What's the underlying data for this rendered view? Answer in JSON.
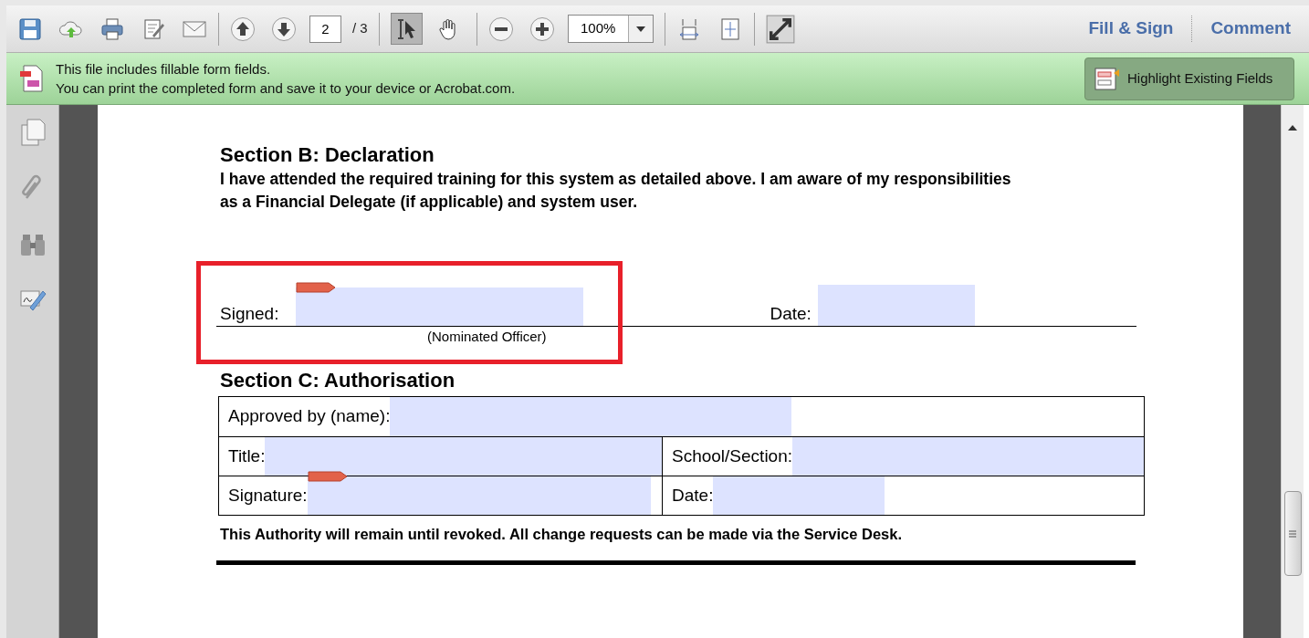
{
  "toolbar": {
    "page_number": "2",
    "page_count": "/ 3",
    "tools": [
      {
        "selected": true
      },
      {
        "selected": false
      }
    ],
    "zoom": "100%",
    "links": [
      "Fill & Sign",
      "Comment"
    ]
  },
  "banner": {
    "lines": [
      "This file includes fillable form fields.",
      "You can print the completed form and save it to your device or Acrobat.com."
    ],
    "button": "Highlight Existing Fields"
  },
  "document": {
    "section_b": {
      "title": "Section B: Declaration",
      "statement": "I have attended the required training for this system as detailed above. I am aware of my responsibilities as a Financial Delegate (if applicable) and system user.",
      "signed_label": "Signed:",
      "signed_note": "(Nominated Officer)",
      "date_label": "Date:",
      "highlighted": true
    },
    "section_c": {
      "title": "Section C: Authorisation",
      "rows": [
        {
          "cells": [
            "Approved by (name):"
          ]
        },
        {
          "cells": [
            "Title:",
            "School/Section:"
          ]
        },
        {
          "cells": [
            "Signature:",
            "Date:"
          ]
        }
      ]
    },
    "footer": "This Authority will remain until revoked.  All change requests can be made via the Service Desk."
  }
}
